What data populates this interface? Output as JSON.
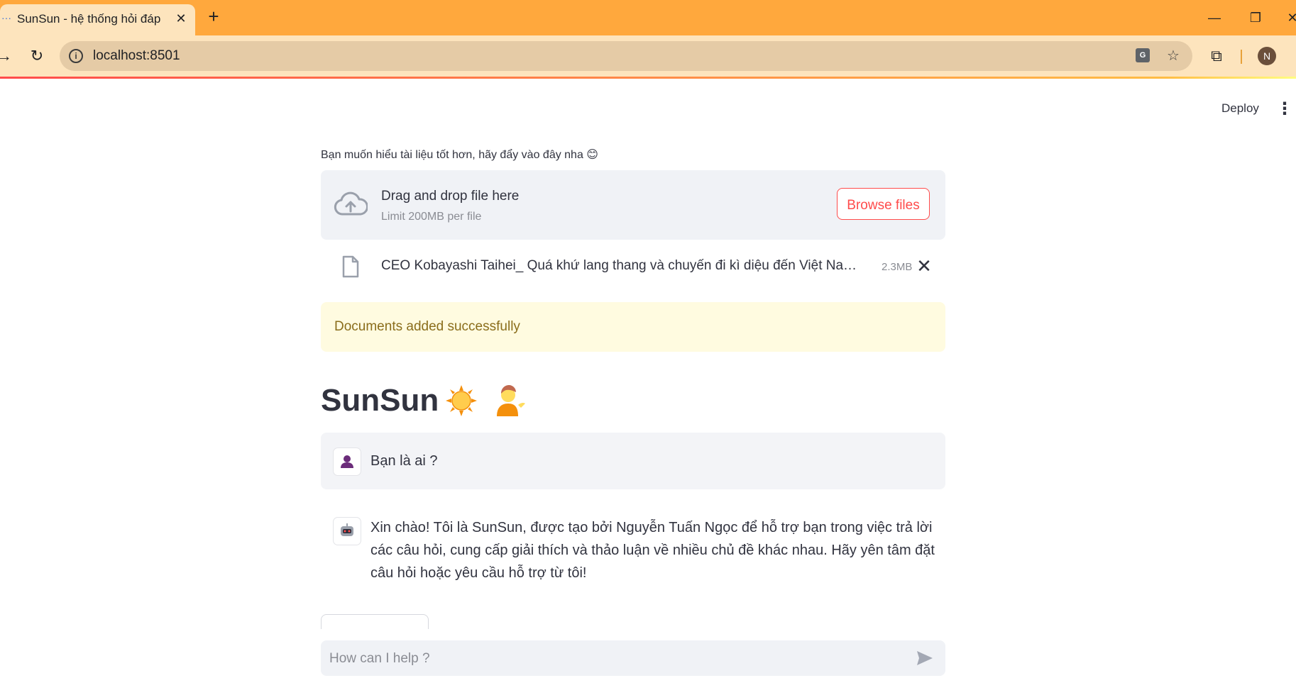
{
  "browser": {
    "tab_title": "SunSun - hệ thống hỏi đáp",
    "url": "localhost:8501",
    "profile_initial": "N"
  },
  "app_header": {
    "deploy_label": "Deploy"
  },
  "uploader": {
    "label": "Bạn muốn hiểu tài liệu tốt hơn, hãy đẩy vào đây nha 😊",
    "drop_title": "Drag and drop file here",
    "limit": "Limit 200MB per file",
    "browse_label": "Browse files",
    "file": {
      "name": "CEO Kobayashi Taihei_ Quá khứ lang thang và chuyến đi kì diệu đến Việt Nam - Su…",
      "size": "2.3MB"
    }
  },
  "alert": {
    "text": "Documents added successfully"
  },
  "app_title": "SunSun",
  "chat": {
    "messages": [
      {
        "role": "user",
        "text": "Bạn là ai ?"
      },
      {
        "role": "assistant",
        "text": "Xin chào! Tôi là SunSun, được tạo bởi Nguyễn Tuấn Ngọc để hỗ trợ bạn trong việc trả lời các câu hỏi, cung cấp giải thích và thảo luận về nhiều chủ đề khác nhau. Hãy yên tâm đặt câu hỏi hoặc yêu cầu hỗ trợ từ tôi!"
      }
    ],
    "input_placeholder": "How can I help ?"
  },
  "colors": {
    "titlebar": "#ffa83d",
    "accent": "#ff4b4b",
    "success_bg": "#fffbe0",
    "success_text": "#8a6d1b"
  }
}
